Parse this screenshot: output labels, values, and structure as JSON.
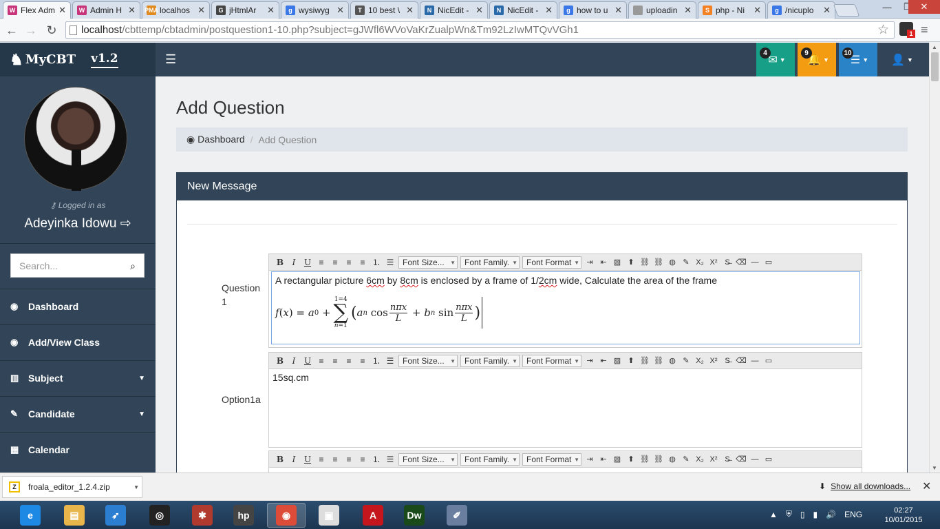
{
  "browser": {
    "tabs": [
      {
        "title": "Flex Adm",
        "fav": "W",
        "color": "#c8347a",
        "active": true
      },
      {
        "title": "Admin H",
        "fav": "W",
        "color": "#c8347a"
      },
      {
        "title": "localhos",
        "fav": "PMA",
        "color": "#e08a1e"
      },
      {
        "title": "jHtmlAr",
        "fav": "G",
        "color": "#444"
      },
      {
        "title": "wysiwyg",
        "fav": "g",
        "color": "#3b78e7"
      },
      {
        "title": "10 best \\",
        "fav": "T",
        "color": "#555"
      },
      {
        "title": "NicEdit -",
        "fav": "N",
        "color": "#2a6aa8"
      },
      {
        "title": "NicEdit -",
        "fav": "N",
        "color": "#2a6aa8"
      },
      {
        "title": "how to u",
        "fav": "g",
        "color": "#3b78e7"
      },
      {
        "title": "uploadin",
        "fav": "",
        "color": "#999"
      },
      {
        "title": "php - Ni",
        "fav": "S",
        "color": "#f48024"
      },
      {
        "title": "/nicuplo",
        "fav": "g",
        "color": "#3b78e7"
      }
    ],
    "url_host": "localhost",
    "url_path": "/cbttemp/cbtadmin/postquestion1-10.php?subject=gJWfl6WVoVaKrZualpWn&Tm92LzIwMTQvVGh1",
    "ext_badge": "1"
  },
  "app": {
    "brand": "MyCBT",
    "version": "v1.2",
    "logged_in_label": "Logged in as",
    "user_name": "Adeyinka Idowu",
    "search_placeholder": "Search...",
    "nav": [
      {
        "label": "Dashboard",
        "icon": "dashboard-icon",
        "glyph": "◉",
        "caret": false
      },
      {
        "label": "Add/View Class",
        "icon": "dashboard-icon",
        "glyph": "◉",
        "caret": false
      },
      {
        "label": "Subject",
        "icon": "bar-chart-icon",
        "glyph": "▥",
        "caret": true
      },
      {
        "label": "Candidate",
        "icon": "edit-icon",
        "glyph": "✎",
        "caret": true
      },
      {
        "label": "Calendar",
        "icon": "calendar-icon",
        "glyph": "▦",
        "caret": false
      }
    ],
    "topbar": {
      "messages_count": "4",
      "alerts_count": "9",
      "tasks_count": "10",
      "colors": {
        "messages": "#17a087",
        "alerts": "#f39c12",
        "tasks": "#2a83c6"
      }
    }
  },
  "page": {
    "title": "Add Question",
    "breadcrumb_home": "Dashboard",
    "breadcrumb_current": "Add Question",
    "panel_title": "New Message",
    "question_label": "Question",
    "question_number": "1",
    "question_text_1": "A rectangular picture ",
    "question_spell_1": "6cm",
    "question_text_2": " by ",
    "question_spell_2": "8cm",
    "question_text_3": " is enclosed by a frame of 1/",
    "question_spell_3": "2cm",
    "question_text_4": " wide, Calculate the area of the frame",
    "option_label": "Option1a",
    "option_text": "15sq.cm"
  },
  "editor_toolbar": {
    "font_size": "Font Size...",
    "font_family": "Font Family.",
    "font_format": "Font Format"
  },
  "downloads": {
    "file": "froala_editor_1.2.4.zip",
    "show_all": "Show all downloads..."
  },
  "taskbar": {
    "language": "ENG",
    "time": "02:27",
    "date": "10/01/2015",
    "apps": [
      {
        "name": "ie-icon",
        "glyph": "e",
        "color": "#1e88e5",
        "active": false
      },
      {
        "name": "file-explorer-icon",
        "glyph": "▤",
        "color": "#e8b64a",
        "active": false
      },
      {
        "name": "rocket-icon",
        "glyph": "➶",
        "color": "#2b7ed0",
        "active": false
      },
      {
        "name": "camera-app-icon",
        "glyph": "◎",
        "color": "#222",
        "active": false
      },
      {
        "name": "puzzle-icon",
        "glyph": "✱",
        "color": "#b03a2e",
        "active": false
      },
      {
        "name": "hp-icon",
        "glyph": "hp",
        "color": "#444",
        "active": false
      },
      {
        "name": "chrome-icon",
        "glyph": "◉",
        "color": "#dd4b39",
        "active": true
      },
      {
        "name": "presentation-icon",
        "glyph": "▣",
        "color": "#ddd",
        "active": false
      },
      {
        "name": "acrobat-icon",
        "glyph": "A",
        "color": "#c4161c",
        "active": false
      },
      {
        "name": "dreamweaver-icon",
        "glyph": "Dw",
        "color": "#1a4a1a",
        "active": false
      },
      {
        "name": "paint-icon",
        "glyph": "✐",
        "color": "#6a7fa0",
        "active": false
      }
    ]
  }
}
